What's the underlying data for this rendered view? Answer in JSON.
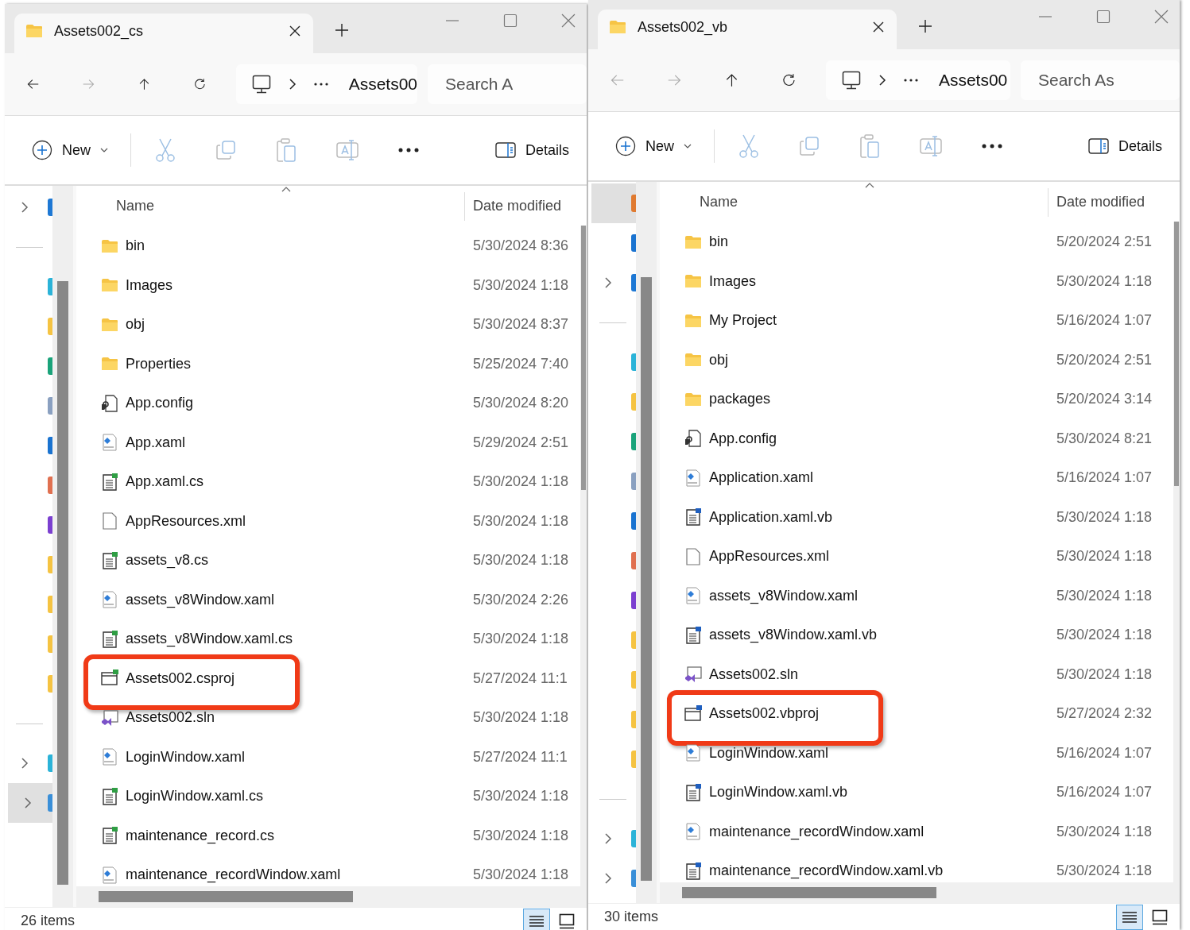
{
  "windows": [
    {
      "tab_title": "Assets002_cs",
      "back_disabled": false,
      "breadcrumb": "Assets00",
      "search_placeholder": "Search A",
      "new_label": "New",
      "details_label": "Details",
      "columns": [
        "Name",
        "Date modified"
      ],
      "status": "26 items",
      "offset": true,
      "sidebar": [
        {
          "kind": "item",
          "expandable": true,
          "selected": false,
          "color": "#1e78d4"
        },
        {
          "kind": "divider"
        },
        {
          "kind": "item",
          "expandable": false,
          "selected": false,
          "color": "#2bb3d8"
        },
        {
          "kind": "item",
          "expandable": false,
          "selected": false,
          "color": "#f5c342"
        },
        {
          "kind": "item",
          "expandable": false,
          "selected": false,
          "color": "#1aa37a"
        },
        {
          "kind": "item",
          "expandable": false,
          "selected": false,
          "color": "#8aa0c0"
        },
        {
          "kind": "item",
          "expandable": false,
          "selected": false,
          "color": "#1a73d0"
        },
        {
          "kind": "item",
          "expandable": false,
          "selected": false,
          "color": "#e07050"
        },
        {
          "kind": "item",
          "expandable": false,
          "selected": false,
          "color": "#7b3fd0"
        },
        {
          "kind": "item",
          "expandable": false,
          "selected": false,
          "color": "#f5c342"
        },
        {
          "kind": "item",
          "expandable": false,
          "selected": false,
          "color": "#f5c342"
        },
        {
          "kind": "item",
          "expandable": false,
          "selected": false,
          "color": "#f5c342"
        },
        {
          "kind": "item",
          "expandable": false,
          "selected": false,
          "color": "#f5c342"
        },
        {
          "kind": "divider"
        },
        {
          "kind": "item",
          "expandable": true,
          "selected": false,
          "color": "#2bb3d8"
        },
        {
          "kind": "item",
          "expandable": true,
          "selected": true,
          "color": "#3a8fd8"
        }
      ],
      "rows": [
        {
          "kind": "folder",
          "name": "bin",
          "date": "5/30/2024 8:36",
          "highlighted": false
        },
        {
          "kind": "folder",
          "name": "Images",
          "date": "5/30/2024 1:18",
          "highlighted": false
        },
        {
          "kind": "folder",
          "name": "obj",
          "date": "5/30/2024 8:37",
          "highlighted": false
        },
        {
          "kind": "folder",
          "name": "Properties",
          "date": "5/25/2024 7:40",
          "highlighted": false
        },
        {
          "kind": "config",
          "name": "App.config",
          "date": "5/30/2024 8:20",
          "highlighted": false
        },
        {
          "kind": "xaml",
          "name": "App.xaml",
          "date": "5/29/2024 2:51",
          "highlighted": false
        },
        {
          "kind": "cs",
          "name": "App.xaml.cs",
          "date": "5/30/2024 1:18",
          "highlighted": false
        },
        {
          "kind": "blank",
          "name": "AppResources.xml",
          "date": "5/30/2024 1:18",
          "highlighted": false
        },
        {
          "kind": "cs",
          "name": "assets_v8.cs",
          "date": "5/30/2024 1:18",
          "highlighted": false
        },
        {
          "kind": "xaml",
          "name": "assets_v8Window.xaml",
          "date": "5/30/2024 2:26",
          "highlighted": false
        },
        {
          "kind": "cs",
          "name": "assets_v8Window.xaml.cs",
          "date": "5/30/2024 1:18",
          "highlighted": false
        },
        {
          "kind": "csproj",
          "name": "Assets002.csproj",
          "date": "5/27/2024 11:1",
          "highlighted": true
        },
        {
          "kind": "sln",
          "name": "Assets002.sln",
          "date": "5/30/2024 1:18",
          "highlighted": false
        },
        {
          "kind": "xaml",
          "name": "LoginWindow.xaml",
          "date": "5/27/2024 11:1",
          "highlighted": false
        },
        {
          "kind": "cs",
          "name": "LoginWindow.xaml.cs",
          "date": "5/30/2024 1:18",
          "highlighted": false
        },
        {
          "kind": "cs",
          "name": "maintenance_record.cs",
          "date": "5/30/2024 1:18",
          "highlighted": false
        },
        {
          "kind": "xaml",
          "name": "maintenance_recordWindow.xaml",
          "date": "5/30/2024 1:18",
          "highlighted": false
        }
      ]
    },
    {
      "tab_title": "Assets002_vb",
      "back_disabled": true,
      "breadcrumb": "Assets00",
      "search_placeholder": "Search As",
      "new_label": "New",
      "details_label": "Details",
      "columns": [
        "Name",
        "Date modified"
      ],
      "status": "30 items",
      "offset": false,
      "sidebar": [
        {
          "kind": "item",
          "expandable": false,
          "selected": true,
          "color": "#e07a30"
        },
        {
          "kind": "item",
          "expandable": false,
          "selected": false,
          "color": "#1a73d0"
        },
        {
          "kind": "item",
          "expandable": true,
          "selected": false,
          "color": "#1e78d4"
        },
        {
          "kind": "divider"
        },
        {
          "kind": "item",
          "expandable": false,
          "selected": false,
          "color": "#2bb3d8"
        },
        {
          "kind": "item",
          "expandable": false,
          "selected": false,
          "color": "#f5c342"
        },
        {
          "kind": "item",
          "expandable": false,
          "selected": false,
          "color": "#1aa37a"
        },
        {
          "kind": "item",
          "expandable": false,
          "selected": false,
          "color": "#8aa0c0"
        },
        {
          "kind": "item",
          "expandable": false,
          "selected": false,
          "color": "#1a73d0"
        },
        {
          "kind": "item",
          "expandable": false,
          "selected": false,
          "color": "#e07050"
        },
        {
          "kind": "item",
          "expandable": false,
          "selected": false,
          "color": "#7b3fd0"
        },
        {
          "kind": "item",
          "expandable": false,
          "selected": false,
          "color": "#f5c342"
        },
        {
          "kind": "item",
          "expandable": false,
          "selected": false,
          "color": "#f5c342"
        },
        {
          "kind": "item",
          "expandable": false,
          "selected": false,
          "color": "#f5c342"
        },
        {
          "kind": "item",
          "expandable": false,
          "selected": false,
          "color": "#f5c342"
        },
        {
          "kind": "divider"
        },
        {
          "kind": "item",
          "expandable": true,
          "selected": false,
          "color": "#2bb3d8"
        },
        {
          "kind": "item",
          "expandable": true,
          "selected": false,
          "color": "#3a8fd8"
        }
      ],
      "rows": [
        {
          "kind": "folder",
          "name": "bin",
          "date": "5/20/2024 2:51",
          "highlighted": false
        },
        {
          "kind": "folder",
          "name": "Images",
          "date": "5/30/2024 1:18",
          "highlighted": false
        },
        {
          "kind": "folder",
          "name": "My Project",
          "date": "5/16/2024 1:07",
          "highlighted": false
        },
        {
          "kind": "folder",
          "name": "obj",
          "date": "5/20/2024 2:51",
          "highlighted": false
        },
        {
          "kind": "folder",
          "name": "packages",
          "date": "5/20/2024 3:14",
          "highlighted": false
        },
        {
          "kind": "config",
          "name": "App.config",
          "date": "5/30/2024 8:21",
          "highlighted": false
        },
        {
          "kind": "xaml",
          "name": "Application.xaml",
          "date": "5/16/2024 1:07",
          "highlighted": false
        },
        {
          "kind": "vb",
          "name": "Application.xaml.vb",
          "date": "5/30/2024 1:18",
          "highlighted": false
        },
        {
          "kind": "blank",
          "name": "AppResources.xml",
          "date": "5/30/2024 1:18",
          "highlighted": false
        },
        {
          "kind": "xaml",
          "name": "assets_v8Window.xaml",
          "date": "5/30/2024 1:18",
          "highlighted": false
        },
        {
          "kind": "vb",
          "name": "assets_v8Window.xaml.vb",
          "date": "5/30/2024 1:18",
          "highlighted": false
        },
        {
          "kind": "sln",
          "name": "Assets002.sln",
          "date": "5/30/2024 1:18",
          "highlighted": false
        },
        {
          "kind": "vbproj",
          "name": "Assets002.vbproj",
          "date": "5/27/2024 2:32",
          "highlighted": true
        },
        {
          "kind": "xaml",
          "name": "LoginWindow.xaml",
          "date": "5/16/2024 1:07",
          "highlighted": false
        },
        {
          "kind": "vb",
          "name": "LoginWindow.xaml.vb",
          "date": "5/16/2024 1:07",
          "highlighted": false
        },
        {
          "kind": "xaml",
          "name": "maintenance_recordWindow.xaml",
          "date": "5/30/2024 1:18",
          "highlighted": false
        },
        {
          "kind": "vb",
          "name": "maintenance_recordWindow.xaml.vb",
          "date": "5/30/2024 1:18",
          "highlighted": false
        }
      ]
    }
  ]
}
